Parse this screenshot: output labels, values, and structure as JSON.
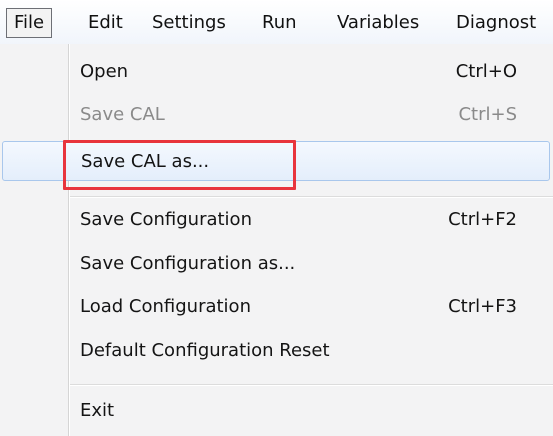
{
  "menubar": {
    "items": [
      {
        "label": "File"
      },
      {
        "label": "Edit"
      },
      {
        "label": "Settings"
      },
      {
        "label": "Run"
      },
      {
        "label": "Variables"
      },
      {
        "label": "Diagnost"
      }
    ]
  },
  "file_menu": {
    "items": [
      {
        "label": "Open",
        "shortcut": "Ctrl+O",
        "enabled": true
      },
      {
        "label": "Save CAL",
        "shortcut": "Ctrl+S",
        "enabled": false
      },
      {
        "label": "Save CAL as...",
        "shortcut": "",
        "enabled": true,
        "highlighted": true
      },
      {
        "label": "Save Configuration",
        "shortcut": "Ctrl+F2",
        "enabled": true
      },
      {
        "label": "Save Configuration as...",
        "shortcut": "",
        "enabled": true
      },
      {
        "label": "Load Configuration",
        "shortcut": "Ctrl+F3",
        "enabled": true
      },
      {
        "label": "Default Configuration Reset",
        "shortcut": "",
        "enabled": true
      },
      {
        "label": "Exit",
        "shortcut": "",
        "enabled": true
      }
    ]
  },
  "colors": {
    "annotation_box": "#e8343d",
    "hover_border": "#a9c7ec",
    "disabled_text": "#8a8a8a"
  }
}
